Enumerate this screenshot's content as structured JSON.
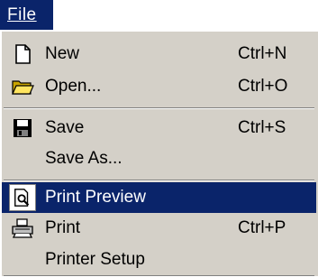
{
  "menubar": {
    "file_label": "File"
  },
  "menu": {
    "items": [
      {
        "label": "New",
        "shortcut": "Ctrl+N",
        "icon": "new-document-icon"
      },
      {
        "label": "Open...",
        "shortcut": "Ctrl+O",
        "icon": "folder-open-icon"
      },
      {
        "label": "Save",
        "shortcut": "Ctrl+S",
        "icon": "floppy-disk-icon"
      },
      {
        "label": "Save As...",
        "shortcut": ""
      },
      {
        "label": "Print Preview",
        "shortcut": "",
        "icon": "print-preview-icon",
        "selected": true
      },
      {
        "label": "Print",
        "shortcut": "Ctrl+P",
        "icon": "printer-icon"
      },
      {
        "label": "Printer Setup",
        "shortcut": ""
      }
    ]
  },
  "colors": {
    "highlight": "#0a246a",
    "menu_face": "#d4d0c8"
  }
}
